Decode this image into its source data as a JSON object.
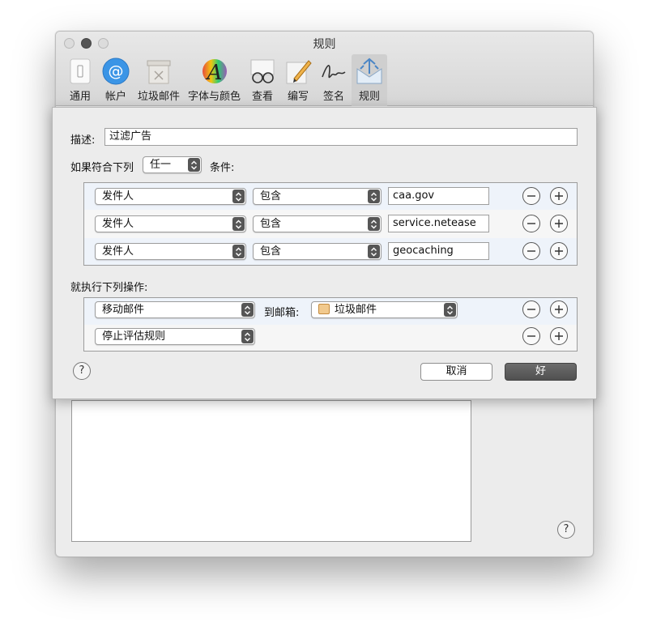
{
  "window": {
    "title": "规则",
    "toolbar": [
      {
        "label": "通用",
        "icon": "switch-icon"
      },
      {
        "label": "帐户",
        "icon": "at-sign-icon"
      },
      {
        "label": "垃圾邮件",
        "icon": "junk-bin-icon"
      },
      {
        "label": "字体与颜色",
        "icon": "font-color-icon"
      },
      {
        "label": "查看",
        "icon": "glasses-icon"
      },
      {
        "label": "编写",
        "icon": "pencil-icon"
      },
      {
        "label": "签名",
        "icon": "signature-icon"
      },
      {
        "label": "规则",
        "icon": "rules-icon",
        "active": true
      }
    ],
    "help": "?"
  },
  "sheet": {
    "description_label": "描述:",
    "description_value": "过滤广告",
    "match_prefix": "如果符合下列",
    "match_value": "任一",
    "match_suffix": "条件:",
    "conditions": [
      {
        "field": "发件人",
        "operator": "包含",
        "value": "caa.gov"
      },
      {
        "field": "发件人",
        "operator": "包含",
        "value": "service.netease"
      },
      {
        "field": "发件人",
        "operator": "包含",
        "value": "geocaching"
      }
    ],
    "actions_label": "就执行下列操作:",
    "actions": [
      {
        "action": "移动邮件",
        "target_label": "到邮箱:",
        "mailbox": "垃圾邮件"
      },
      {
        "action": "停止评估规则"
      }
    ],
    "help": "?",
    "cancel_label": "取消",
    "ok_label": "好"
  },
  "colors": {
    "accent_dark": "#565656",
    "alt_row": "#eef3fa"
  }
}
